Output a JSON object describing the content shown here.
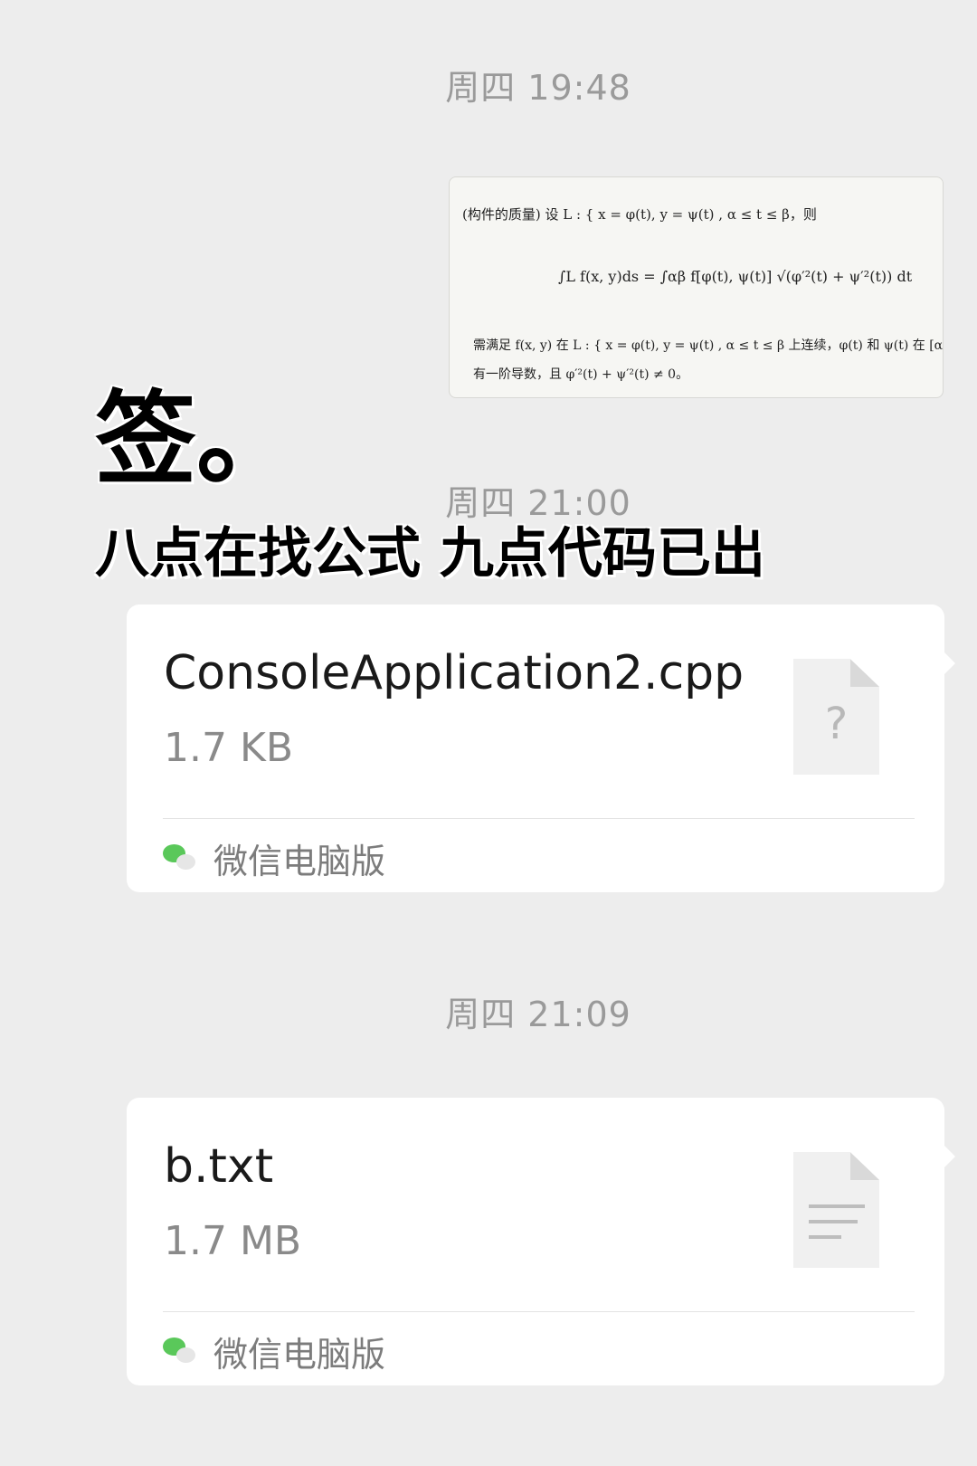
{
  "timestamps": [
    "周四 19:48",
    "周四 21:00",
    "周四 21:09"
  ],
  "image_message": {
    "line1": "(构件的质量) 设 L : { x = φ(t), y = ψ(t) ,   α ≤ t ≤ β，则",
    "line2": "∫L f(x, y)ds = ∫αβ f[φ(t), ψ(t)] √(φ′²(t) + ψ′²(t)) dt",
    "line3": "需满足 f(x, y) 在 L : { x = φ(t), y = ψ(t) ,   α ≤ t ≤ β 上连续，φ(t) 和 ψ(t) 在 [α, β] 上具",
    "line4": "有一阶导数，且 φ′²(t) + ψ′²(t) ≠ 0。"
  },
  "overlay": {
    "big": "签。",
    "line": "八点在找公式 九点代码已出"
  },
  "files": [
    {
      "name": "ConsoleApplication2.cpp",
      "size": "1.7 KB",
      "source": "微信电脑版",
      "icon": "unknown-file-icon"
    },
    {
      "name": "b.txt",
      "size": "1.7 MB",
      "source": "微信电脑版",
      "icon": "text-file-icon"
    }
  ],
  "colors": {
    "background": "#ededed",
    "card": "#ffffff",
    "wechat_green": "#5ac85a"
  }
}
